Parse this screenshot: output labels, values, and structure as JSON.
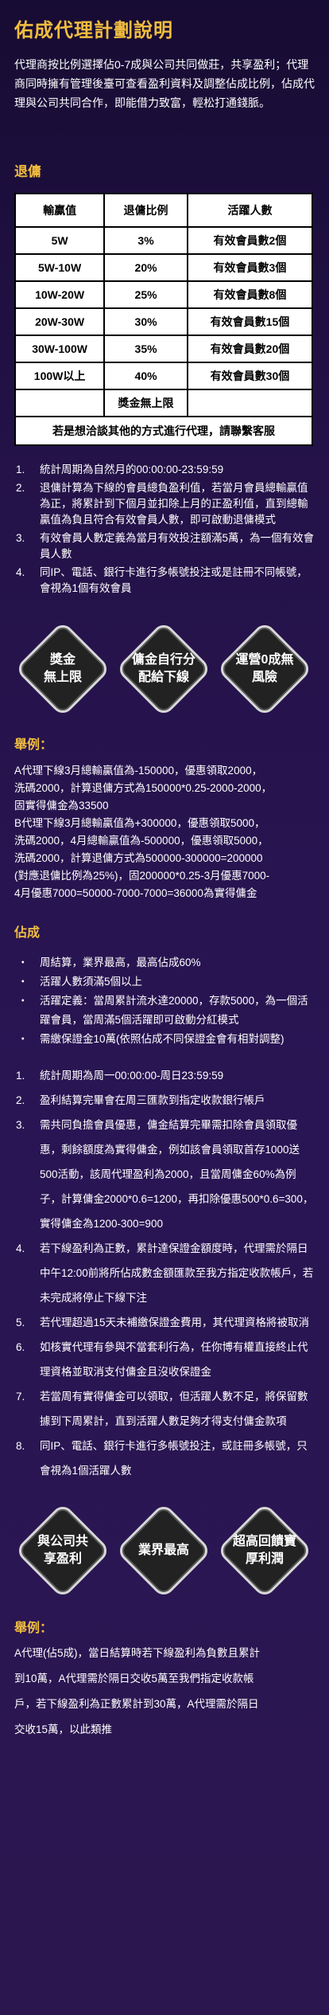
{
  "page_title": "佑成代理計劃說明",
  "intro": "代理商按比例選擇佔0-7成與公司共同做莊，共享盈利；代理商同時擁有管理後臺可查看盈利資料及調整佔成比例，佔成代理與公司共同合作，即能借力致富，輕松打通錢脈。",
  "rebate": {
    "title": "退傭",
    "headers": [
      "輸贏值",
      "退傭比例",
      "活躍人數"
    ],
    "rows": [
      [
        "5W",
        "3%",
        "有效會員數2個"
      ],
      [
        "5W-10W",
        "20%",
        "有效會員數3個"
      ],
      [
        "10W-20W",
        "25%",
        "有效會員數8個"
      ],
      [
        "20W-30W",
        "30%",
        "有效會員數15個"
      ],
      [
        "30W-100W",
        "35%",
        "有效會員數20個"
      ],
      [
        "100W以上",
        "40%",
        "有效會員數30個"
      ]
    ],
    "bonus_row": "獎金無上限",
    "footer": "若是想洽談其他的方式進行代理，請聯繫客服",
    "notes": [
      {
        "n": "1.",
        "t": "統計周期為自然月的00:00:00-23:59:59"
      },
      {
        "n": "2.",
        "t": "退傭計算為下線的會員總負盈利值，若當月會員總輸贏值為正，將累計到下個月並扣除上月的正盈利值，直到總輸贏值為負且符合有效會員人數，即可啟動退傭模式"
      },
      {
        "n": "3.",
        "t": "有效會員人數定義為當月有效投注額滿5萬，為一個有效會員人數"
      },
      {
        "n": "4.",
        "t": "同IP、電話、銀行卡進行多帳號投注或是註冊不同帳號，會視為1個有效會員"
      }
    ],
    "diamonds": [
      "獎金\n無上限",
      "傭金自行分\n配給下線",
      "運營0成無\n風險"
    ],
    "example_title": "舉例：",
    "example_lines": [
      "A代理下線3月總輸贏值為-150000，優惠領取2000，",
      "洗碼2000，計算退傭方式為150000*0.25-2000-2000，",
      "固實得傭金為33500",
      "B代理下線3月總輸贏值為+300000，優惠領取5000，",
      "洗碼2000，4月總輸贏值為-500000，優惠領取5000，",
      "洗碼2000，計算退傭方式為500000-300000=200000",
      "(對應退傭比例為25%)，固200000*0.25-3月優惠7000-",
      "4月優惠7000=50000-7000-7000=36000為實得傭金"
    ]
  },
  "share": {
    "title": "佔成",
    "bullets": [
      {
        "d": "・",
        "t": "周結算，業界最高，最高佔成60%"
      },
      {
        "d": "・",
        "t": "活躍人數須滿5個以上"
      },
      {
        "d": "・",
        "t": "活躍定義：當周累計流水達20000，存款5000，為一個活躍會員，當周滿5個活躍即可啟動分紅模式"
      },
      {
        "d": "・",
        "t": "需繳保證金10萬(依照佔成不同保證金會有相對調整)"
      }
    ],
    "notes": [
      {
        "n": "1.",
        "t": "統計周期為周一00:00:00-周日23:59:59"
      },
      {
        "n": "2.",
        "t": "盈利結算完畢會在周三匯款到指定收款銀行帳戶"
      },
      {
        "n": "3.",
        "t": "需共同負擔會員優惠，傭金結算完畢需扣除會員領取優惠，剩餘額度為實得傭金，例如該會員領取首存1000送500活動，該周代理盈利為2000，且當周傭金60%為例子，計算傭金2000*0.6=1200，再扣除優惠500*0.6=300，實得傭金為1200-300=900"
      },
      {
        "n": "4.",
        "t": "若下線盈利為正數，累計達保證金額度時，代理需於隔日中午12:00前將所佔成數金額匯款至我方指定收款帳戶，若未完成將停止下線下注"
      },
      {
        "n": "5.",
        "t": "若代理超過15天未補繳保證金費用，其代理資格將被取消"
      },
      {
        "n": "6.",
        "t": "如核實代理有參與不當套利行為，任你博有權直接終止代理資格並取消支付傭金且沒收保證金"
      },
      {
        "n": "7.",
        "t": "若當周有實得傭金可以領取，但活躍人數不足，將保留數據到下周累計，直到活躍人數足夠才得支付傭金款項"
      },
      {
        "n": "8.",
        "t": "同IP、電話、銀行卡進行多帳號投注，或註冊多帳號，只會視為1個活躍人數"
      }
    ],
    "diamonds": [
      "與公司共\n享盈利",
      "業界最高",
      "超高回饋寶\n厚利潤"
    ],
    "example_title": "舉例：",
    "example_lines": [
      "A代理(佔5成)，當日結算時若下線盈利為負數且累計",
      "到10萬，A代理需於隔日交收5萬至我們指定收款帳",
      "戶，若下線盈利為正數累計到30萬，A代理需於隔日",
      "交收15萬，以此類推"
    ]
  }
}
